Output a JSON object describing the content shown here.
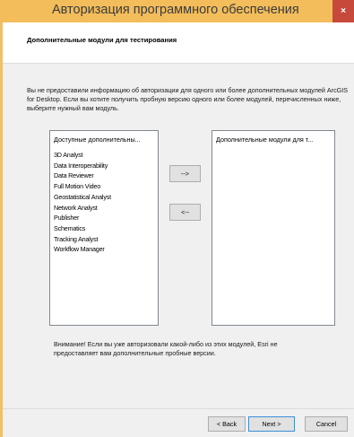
{
  "window": {
    "title": "Авторизация программного обеспечения",
    "close_label": "×"
  },
  "header": {
    "title": "Дополнительные модули для тестирования"
  },
  "description": "Вы не предоставили информацию об авторизации для одного или более дополнительных модулей ArcGIS for Desktop.  Если вы хотите получить пробную версию одного или более модулей, перечисленных ниже, выберите нужный вам модуль.",
  "available_list": {
    "header": "Доступные дополнительны...",
    "items": [
      "3D Analyst",
      "Data Interoperability",
      "Data Reviewer",
      "Full Motion Video",
      "Geostatistical Analyst",
      "Network Analyst",
      "Publisher",
      "Schematics",
      "Tracking Analyst",
      "Workflow Manager"
    ]
  },
  "selected_list": {
    "header": "Дополнительные модули для т..."
  },
  "buttons": {
    "add": "-->",
    "remove": "<--",
    "back": "< Back",
    "next": "Next >",
    "cancel": "Cancel"
  },
  "note": "Внимание! Если вы уже авторизовали какой-либо из этих модулей, Esri не предоставляет вам дополнительные пробные версии.",
  "colors": {
    "titlebar": "#f3bd5b",
    "close_button": "#c7493b",
    "panel_bg": "#f0f0f0",
    "default_button_border": "#3c8fd8"
  }
}
